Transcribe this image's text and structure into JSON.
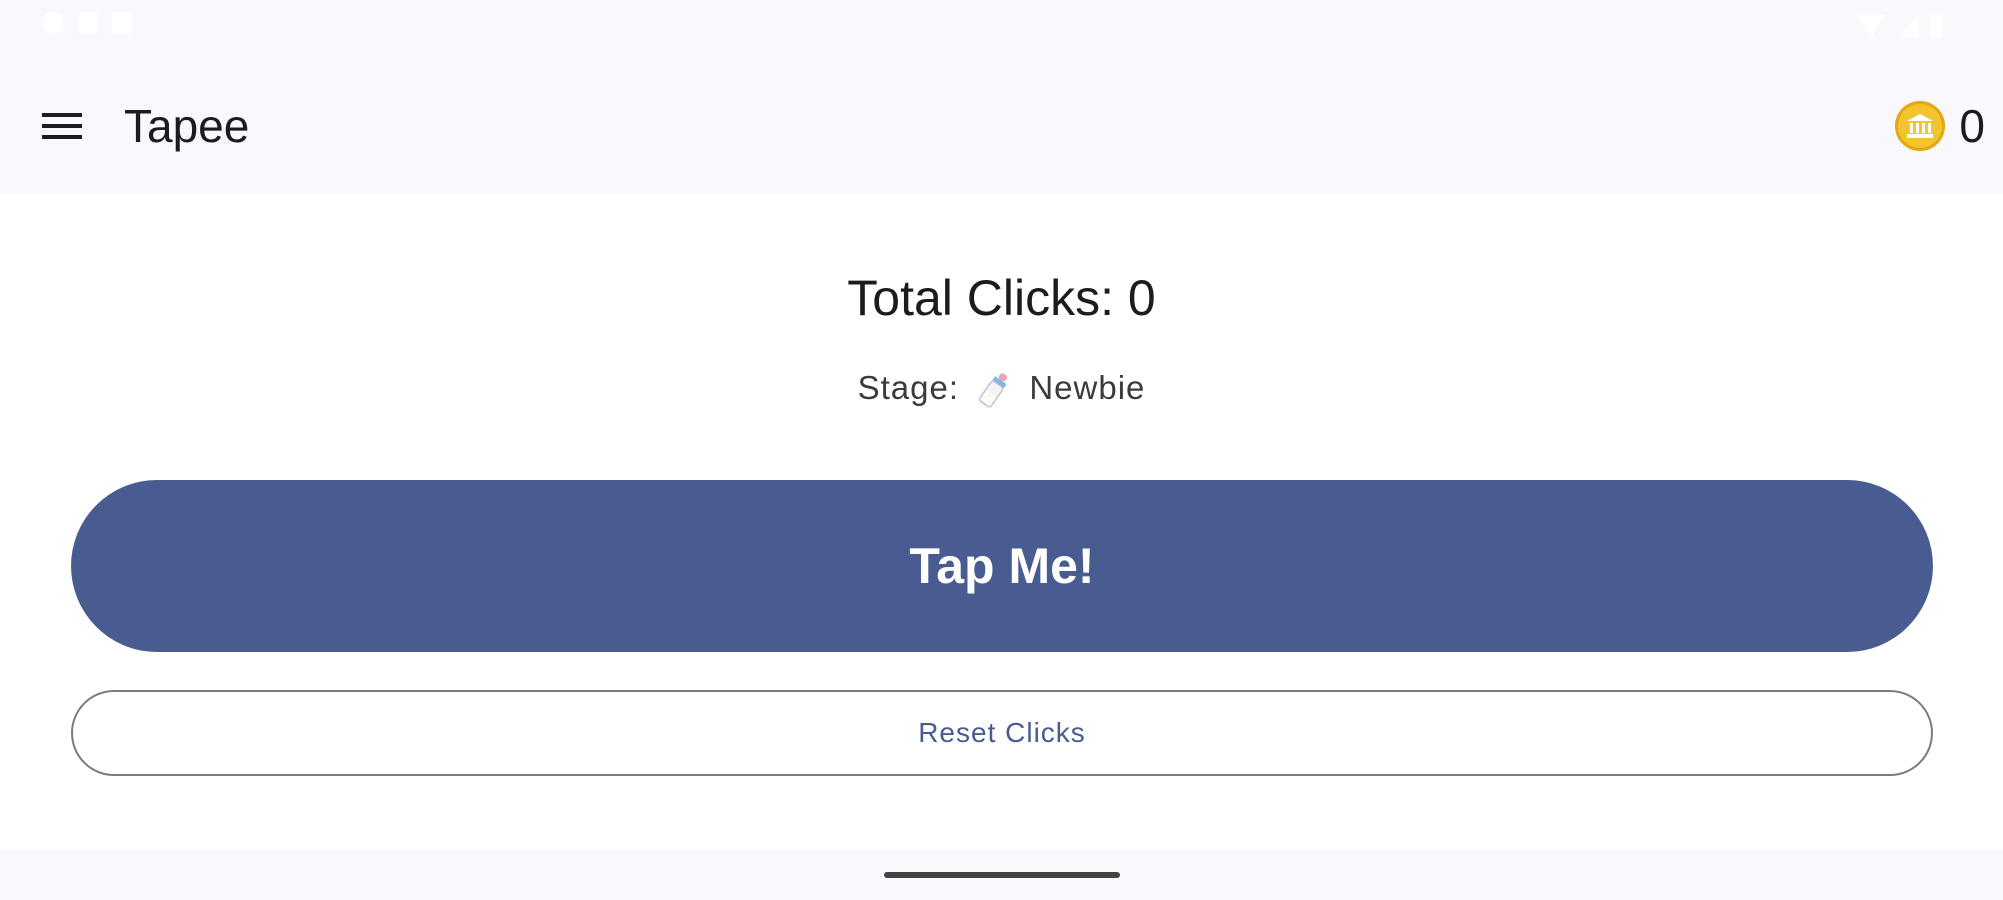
{
  "app_bar": {
    "title": "Tapee",
    "coin_count": "0",
    "coin_icon": "bank-coin-icon"
  },
  "main": {
    "total_clicks": "Total Clicks: 0",
    "stage_prefix": "Stage:",
    "stage_icon": "baby-bottle-icon",
    "stage_name": "Newbie",
    "tap_label": "Tap Me!",
    "reset_label": "Reset Clicks"
  },
  "colors": {
    "primary": "#485c91",
    "coin": "#f4c430",
    "surface": "#f8f8fd"
  }
}
